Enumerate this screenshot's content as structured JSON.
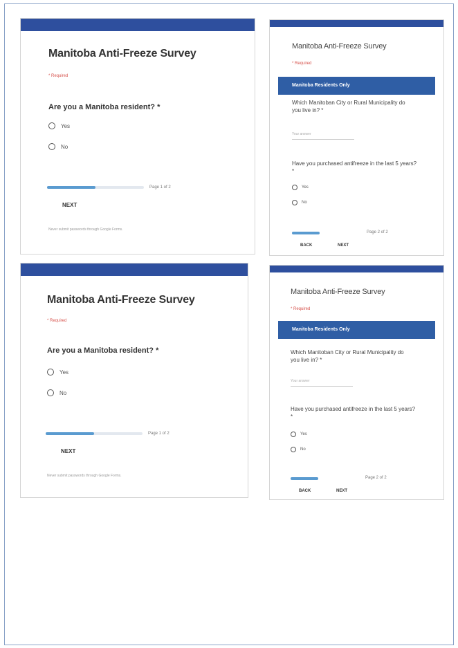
{
  "survey": {
    "title": "Manitoba Anti-Freeze Survey",
    "required_note": "* Required",
    "page1": {
      "question": "Are you a Manitoba resident? *",
      "options": [
        "Yes",
        "No"
      ],
      "progress_fraction": 0.5,
      "page_count": "Page 1 of 2",
      "next_label": "NEXT",
      "footer": "Never submit passwords through Google Forms."
    },
    "page2": {
      "section_title": "Manitoba Residents Only",
      "question1": "Which Manitoban City or Rural Municipality do you live in? *",
      "answer_placeholder": "Your answer",
      "question2": "Have you purchased antifreeze in the last 5 years? *",
      "options": [
        "Yes",
        "No"
      ],
      "progress_fraction": 1.0,
      "page_count": "Page 2 of 2",
      "back_label": "BACK",
      "next_label": "NEXT"
    }
  },
  "colors": {
    "header_bar": "#2e4f9e",
    "section_header": "#2f5ea5",
    "progress_fill": "#5a9bd0",
    "required": "#d6504a"
  }
}
